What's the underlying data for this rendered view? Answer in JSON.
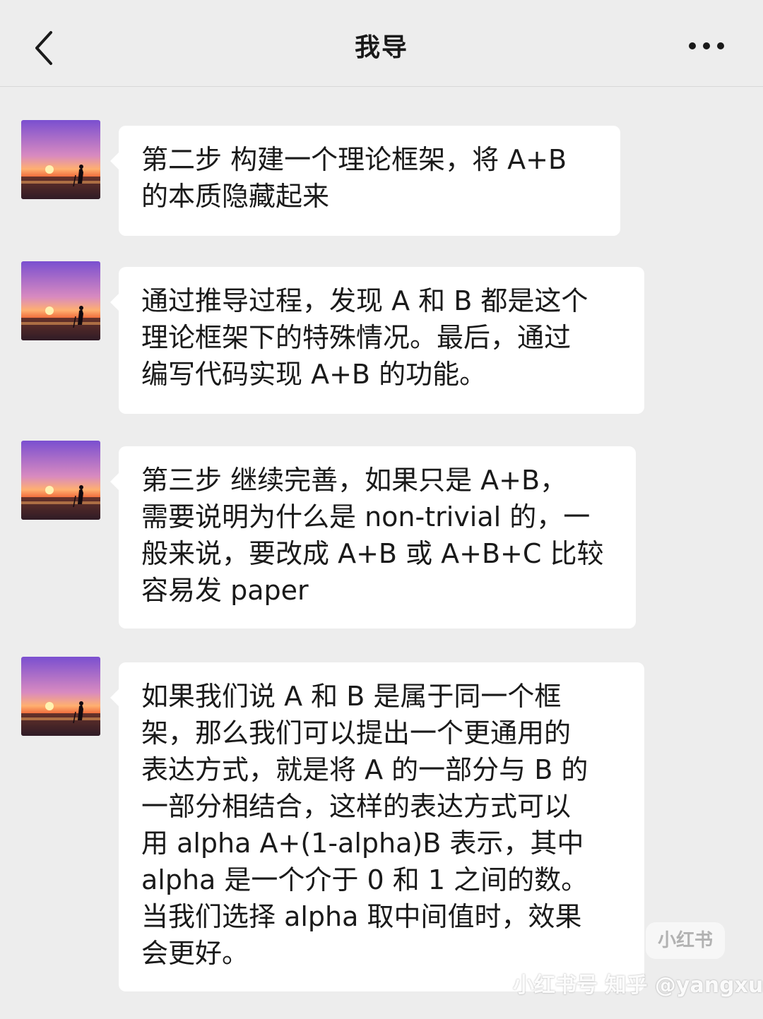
{
  "header": {
    "title": "我导",
    "back_icon": "chevron-left-icon",
    "more_icon": "ellipsis-icon"
  },
  "messages": [
    {
      "text": "第二步 构建一个理论框架，将 A+B\n的本质隐藏起来"
    },
    {
      "text": "通过推导过程，发现 A 和 B 都是这个\n理论框架下的特殊情况。最后，通过\n编写代码实现 A+B 的功能。"
    },
    {
      "text": "第三步 继续完善，如果只是 A+B，\n需要说明为什么是 non-trivial 的，一\n般来说，要改成 A+B 或 A+B+C 比较\n容易发 paper"
    },
    {
      "text": "如果我们说 A 和 B 是属于同一个框\n架，那么我们可以提出一个更通用的\n表达方式，就是将 A 的一部分与 B 的\n一部分相结合，这样的表达方式可以\n用 alpha A+(1-alpha)B 表示，其中\nalpha 是一个介于 0 和 1 之间的数。\n当我们选择 alpha 取中间值时，效果\n会更好。"
    }
  ],
  "watermark": {
    "logo_text": "小红书",
    "credit_text": "小红书号 知乎 @yangxue"
  },
  "colors": {
    "background": "#ededed",
    "bubble": "#ffffff",
    "text": "#1a1a1a"
  }
}
